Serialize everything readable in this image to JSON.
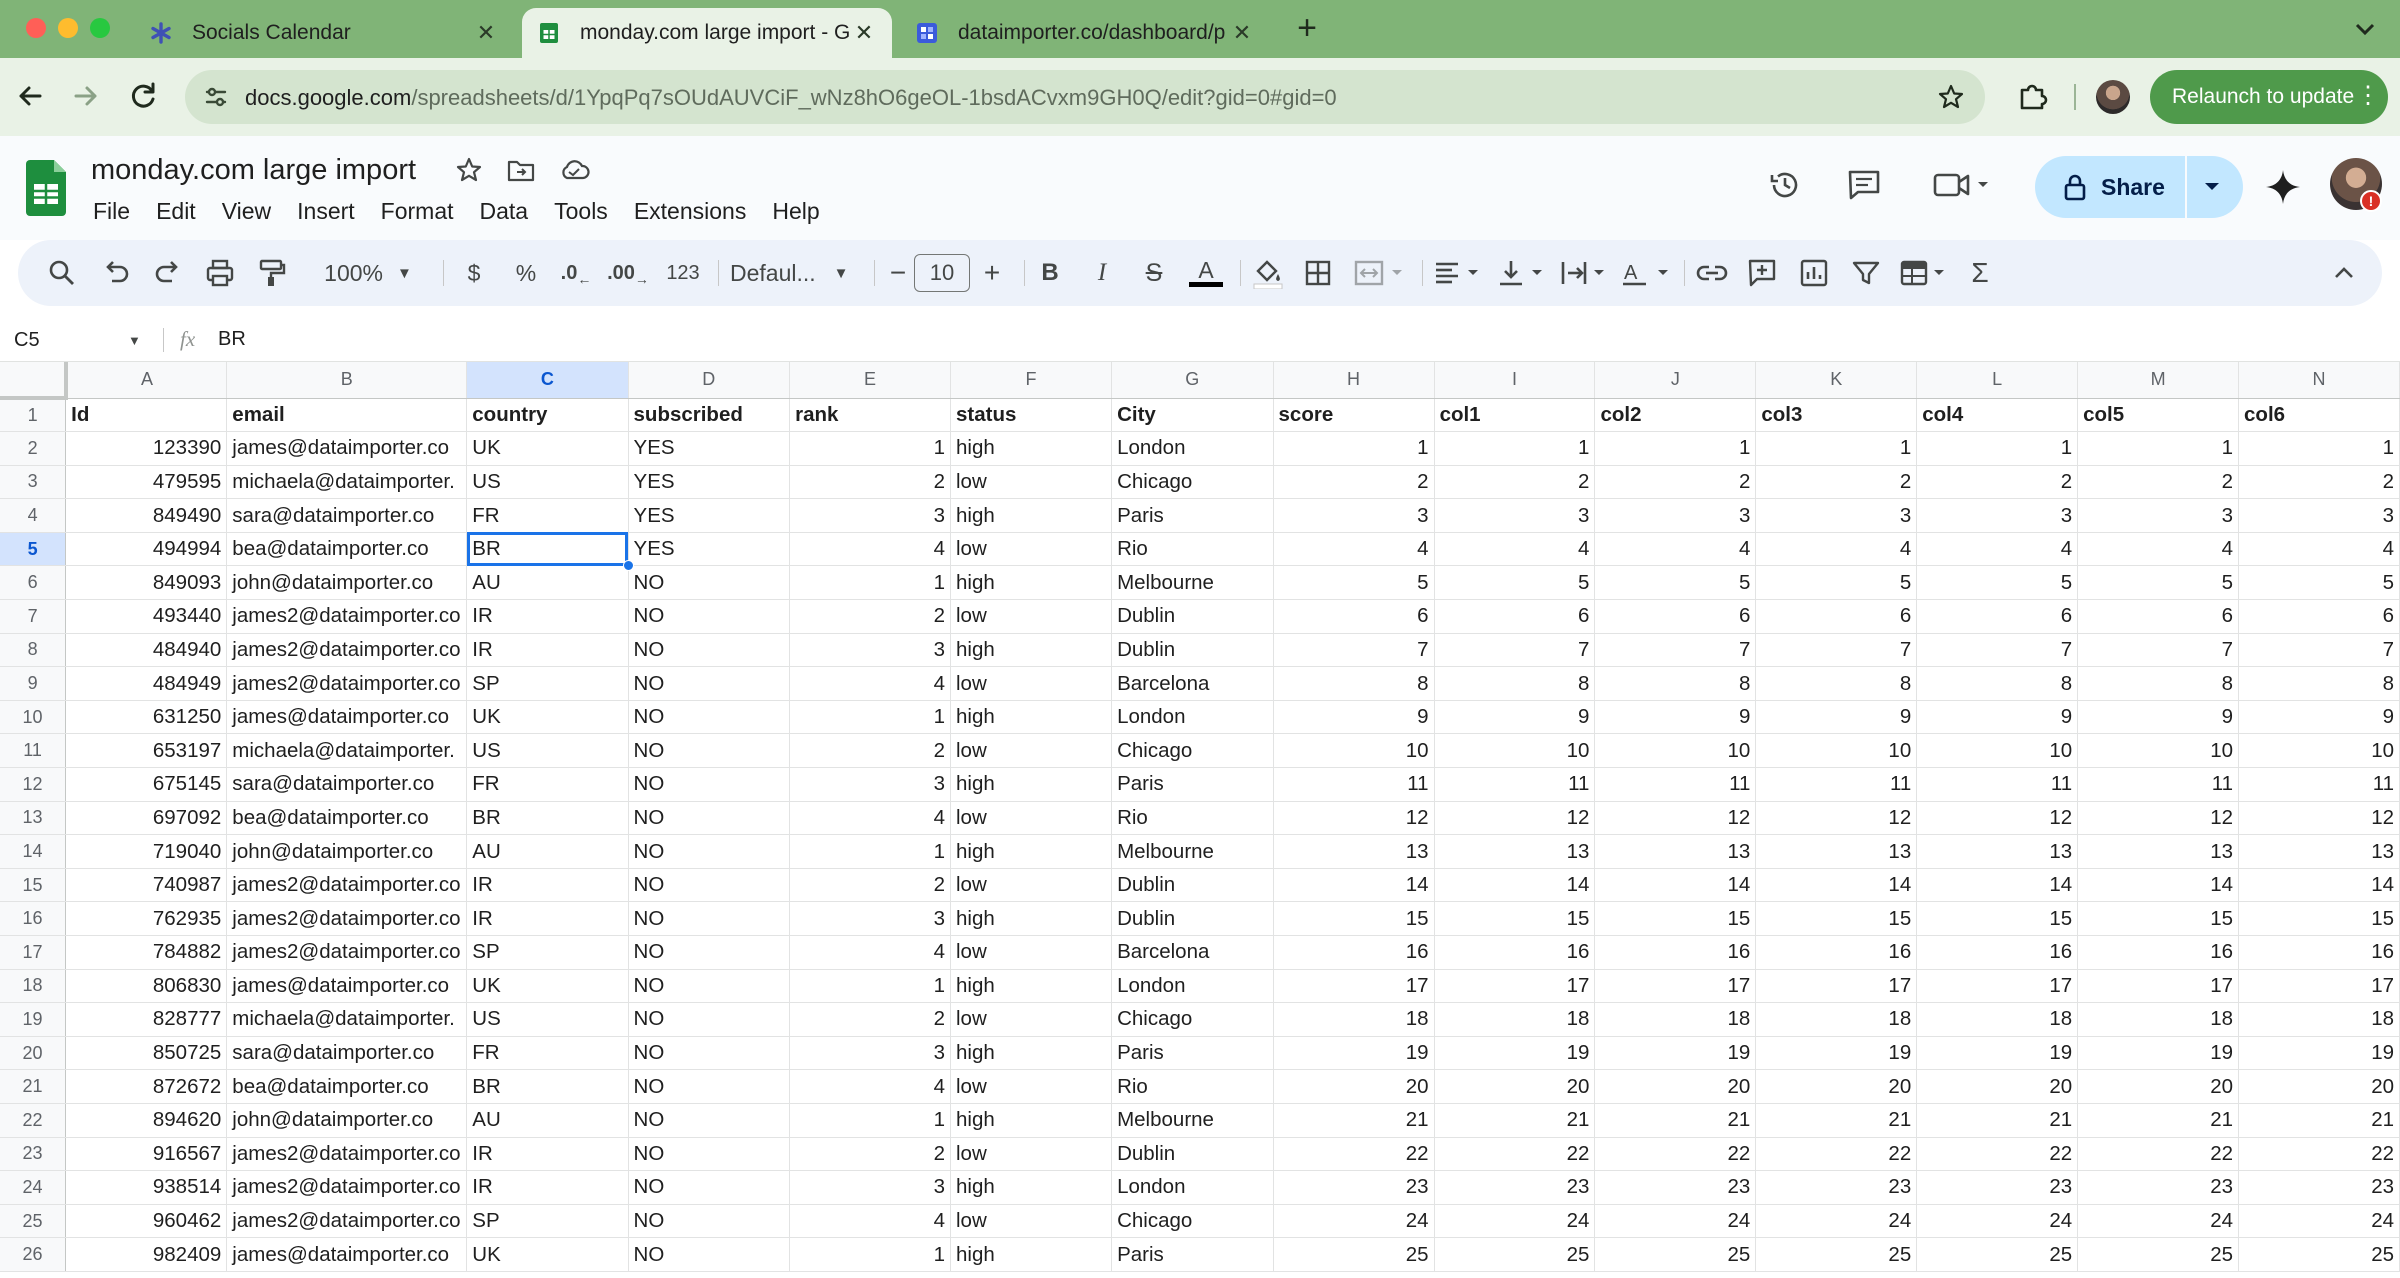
{
  "browser": {
    "tabs": [
      {
        "title": "Socials Calendar"
      },
      {
        "title": "monday.com large import - G"
      },
      {
        "title": "dataimporter.co/dashboard/p"
      }
    ],
    "url_host": "docs.google.com",
    "url_path": "/spreadsheets/d/1YpqPq7sOUdAUVCiF_wNz8hO6geOL-1bsdACvxm9GH0Q/edit?gid=0#gid=0",
    "relaunch_label": "Relaunch to update"
  },
  "doc": {
    "title": "monday.com large import",
    "menus": [
      "File",
      "Edit",
      "View",
      "Insert",
      "Format",
      "Data",
      "Tools",
      "Extensions",
      "Help"
    ],
    "share_label": "Share"
  },
  "toolbar": {
    "zoom": "100%",
    "currency": "$",
    "percent": "%",
    "dec_decrease": ".0",
    "dec_increase": ".00",
    "number_format": "123",
    "font": "Defaul...",
    "font_size": "10"
  },
  "formula_bar": {
    "cell_ref": "C5",
    "fx": "fx",
    "value": "BR"
  },
  "sheet": {
    "column_letters": [
      "A",
      "B",
      "C",
      "D",
      "E",
      "F",
      "G",
      "H",
      "I",
      "J",
      "K",
      "L",
      "M",
      "N"
    ],
    "selected_column": "C",
    "selected_row": "5",
    "rows": [
      [
        "1",
        "Id",
        "email",
        "country",
        "subscribed",
        "rank",
        "status",
        "City",
        "score",
        "col1",
        "col2",
        "col3",
        "col4",
        "col5",
        "col6"
      ],
      [
        "2",
        "123390",
        "james@dataimporter.co",
        "UK",
        "YES",
        "1",
        "high",
        "London",
        "1",
        "1",
        "1",
        "1",
        "1",
        "1",
        "1"
      ],
      [
        "3",
        "479595",
        "michaela@dataimporter.",
        "US",
        "YES",
        "2",
        "low",
        "Chicago",
        "2",
        "2",
        "2",
        "2",
        "2",
        "2",
        "2"
      ],
      [
        "4",
        "849490",
        "sara@dataimporter.co",
        "FR",
        "YES",
        "3",
        "high",
        "Paris",
        "3",
        "3",
        "3",
        "3",
        "3",
        "3",
        "3"
      ],
      [
        "5",
        "494994",
        "bea@dataimporter.co",
        "BR",
        "YES",
        "4",
        "low",
        "Rio",
        "4",
        "4",
        "4",
        "4",
        "4",
        "4",
        "4"
      ],
      [
        "6",
        "849093",
        "john@dataimporter.co",
        "AU",
        "NO",
        "1",
        "high",
        "Melbourne",
        "5",
        "5",
        "5",
        "5",
        "5",
        "5",
        "5"
      ],
      [
        "7",
        "493440",
        "james2@dataimporter.co",
        "IR",
        "NO",
        "2",
        "low",
        "Dublin",
        "6",
        "6",
        "6",
        "6",
        "6",
        "6",
        "6"
      ],
      [
        "8",
        "484940",
        "james2@dataimporter.co",
        "IR",
        "NO",
        "3",
        "high",
        "Dublin",
        "7",
        "7",
        "7",
        "7",
        "7",
        "7",
        "7"
      ],
      [
        "9",
        "484949",
        "james2@dataimporter.co",
        "SP",
        "NO",
        "4",
        "low",
        "Barcelona",
        "8",
        "8",
        "8",
        "8",
        "8",
        "8",
        "8"
      ],
      [
        "10",
        "631250",
        "james@dataimporter.co",
        "UK",
        "NO",
        "1",
        "high",
        "London",
        "9",
        "9",
        "9",
        "9",
        "9",
        "9",
        "9"
      ],
      [
        "11",
        "653197",
        "michaela@dataimporter.",
        "US",
        "NO",
        "2",
        "low",
        "Chicago",
        "10",
        "10",
        "10",
        "10",
        "10",
        "10",
        "10"
      ],
      [
        "12",
        "675145",
        "sara@dataimporter.co",
        "FR",
        "NO",
        "3",
        "high",
        "Paris",
        "11",
        "11",
        "11",
        "11",
        "11",
        "11",
        "11"
      ],
      [
        "13",
        "697092",
        "bea@dataimporter.co",
        "BR",
        "NO",
        "4",
        "low",
        "Rio",
        "12",
        "12",
        "12",
        "12",
        "12",
        "12",
        "12"
      ],
      [
        "14",
        "719040",
        "john@dataimporter.co",
        "AU",
        "NO",
        "1",
        "high",
        "Melbourne",
        "13",
        "13",
        "13",
        "13",
        "13",
        "13",
        "13"
      ],
      [
        "15",
        "740987",
        "james2@dataimporter.co",
        "IR",
        "NO",
        "2",
        "low",
        "Dublin",
        "14",
        "14",
        "14",
        "14",
        "14",
        "14",
        "14"
      ],
      [
        "16",
        "762935",
        "james2@dataimporter.co",
        "IR",
        "NO",
        "3",
        "high",
        "Dublin",
        "15",
        "15",
        "15",
        "15",
        "15",
        "15",
        "15"
      ],
      [
        "17",
        "784882",
        "james2@dataimporter.co",
        "SP",
        "NO",
        "4",
        "low",
        "Barcelona",
        "16",
        "16",
        "16",
        "16",
        "16",
        "16",
        "16"
      ],
      [
        "18",
        "806830",
        "james@dataimporter.co",
        "UK",
        "NO",
        "1",
        "high",
        "London",
        "17",
        "17",
        "17",
        "17",
        "17",
        "17",
        "17"
      ],
      [
        "19",
        "828777",
        "michaela@dataimporter.",
        "US",
        "NO",
        "2",
        "low",
        "Chicago",
        "18",
        "18",
        "18",
        "18",
        "18",
        "18",
        "18"
      ],
      [
        "20",
        "850725",
        "sara@dataimporter.co",
        "FR",
        "NO",
        "3",
        "high",
        "Paris",
        "19",
        "19",
        "19",
        "19",
        "19",
        "19",
        "19"
      ],
      [
        "21",
        "872672",
        "bea@dataimporter.co",
        "BR",
        "NO",
        "4",
        "low",
        "Rio",
        "20",
        "20",
        "20",
        "20",
        "20",
        "20",
        "20"
      ],
      [
        "22",
        "894620",
        "john@dataimporter.co",
        "AU",
        "NO",
        "1",
        "high",
        "Melbourne",
        "21",
        "21",
        "21",
        "21",
        "21",
        "21",
        "21"
      ],
      [
        "23",
        "916567",
        "james2@dataimporter.co",
        "IR",
        "NO",
        "2",
        "low",
        "Dublin",
        "22",
        "22",
        "22",
        "22",
        "22",
        "22",
        "22"
      ],
      [
        "24",
        "938514",
        "james2@dataimporter.co",
        "IR",
        "NO",
        "3",
        "high",
        "London",
        "23",
        "23",
        "23",
        "23",
        "23",
        "23",
        "23"
      ],
      [
        "25",
        "960462",
        "james2@dataimporter.co",
        "SP",
        "NO",
        "4",
        "low",
        "Chicago",
        "24",
        "24",
        "24",
        "24",
        "24",
        "24",
        "24"
      ],
      [
        "26",
        "982409",
        "james@dataimporter.co",
        "UK",
        "NO",
        "1",
        "high",
        "Paris",
        "25",
        "25",
        "25",
        "25",
        "25",
        "25",
        "25"
      ]
    ]
  }
}
